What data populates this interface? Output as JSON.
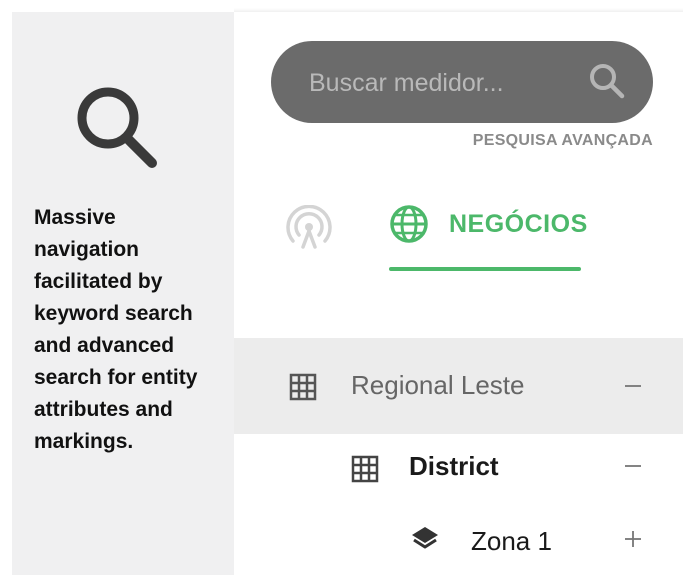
{
  "info_panel": {
    "description": "Massive navigation facilitated by keyword search and advanced search for entity attributes and markings."
  },
  "search": {
    "placeholder": "Buscar medidor...",
    "value": "",
    "advanced_label": "PESQUISA AVANÇADA"
  },
  "tabs": [
    {
      "icon": "antenna-signal-icon",
      "label": "",
      "active": false
    },
    {
      "icon": "globe-icon",
      "label": "NEGÓCIOS",
      "active": true
    }
  ],
  "tree": {
    "items": [
      {
        "label": "Regional Leste",
        "icon": "grid-icon",
        "toggle": "minus",
        "level": 0
      },
      {
        "label": "District",
        "icon": "grid-icon",
        "toggle": "minus",
        "level": 1
      },
      {
        "label": "Zona 1",
        "icon": "layers-icon",
        "toggle": "plus",
        "level": 2
      }
    ]
  },
  "colors": {
    "accent": "#4cb86a",
    "search_bg": "#6b6b6b",
    "panel_bg": "#f0f0f1",
    "selected_row_bg": "#ececec"
  }
}
